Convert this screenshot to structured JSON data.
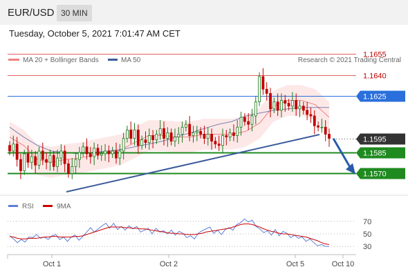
{
  "header": {
    "pair": "EUR/USD",
    "timeframe": "30 MIN"
  },
  "timestamp": "Tuesday, October 5, 2021 7:01:47 AM CET",
  "legend": {
    "ma20_bb": "MA 20 + Bollinger Bands",
    "ma50": "MA 50",
    "copyright": "Research © 2021 Trading Central",
    "ma20_color": "#f08080",
    "ma50_color": "#3d5a99"
  },
  "rsi_legend": {
    "rsi": "RSI",
    "ma9": "9MA",
    "rsi_color": "#5b7fd6",
    "ma9_color": "#cc0000"
  },
  "colors": {
    "up": "#1a7a1a",
    "down": "#c00000",
    "resistance": "#e06060",
    "pivot": "#2a6fdb",
    "support": "#1f8a1f",
    "trend": "#3a5a9a",
    "band_fill": "#fbd9d9"
  },
  "chart_data": {
    "type": "candlestick",
    "x_ticks": [
      "Oct 1",
      "Oct 2",
      "Oct 5",
      "Oct 10"
    ],
    "y_range": [
      1.1556,
      1.1666
    ],
    "levels": [
      {
        "price": 1.1655,
        "label": "1.1655",
        "kind": "resistance"
      },
      {
        "price": 1.164,
        "label": "1.1640",
        "kind": "resistance"
      },
      {
        "price": 1.1625,
        "label": "1.1625",
        "kind": "pivot"
      },
      {
        "price": 1.1595,
        "label": "1.1595",
        "kind": "last"
      },
      {
        "price": 1.1585,
        "label": "1.1585",
        "kind": "support"
      },
      {
        "price": 1.157,
        "label": "1.1570",
        "kind": "support"
      }
    ],
    "closes": [
      1.1586,
      1.1591,
      1.158,
      1.1572,
      1.1584,
      1.1578,
      1.1582,
      1.1576,
      1.1586,
      1.158,
      1.1578,
      1.1583,
      1.1575,
      1.1581,
      1.1586,
      1.1577,
      1.157,
      1.1575,
      1.158,
      1.1585,
      1.1589,
      1.1584,
      1.1582,
      1.1588,
      1.1583,
      1.1584,
      1.1586,
      1.1584,
      1.1586,
      1.1581,
      1.1586,
      1.1595,
      1.1601,
      1.1595,
      1.1601,
      1.159,
      1.1594,
      1.1592,
      1.1597,
      1.1594,
      1.1598,
      1.1602,
      1.1595,
      1.1599,
      1.1593,
      1.1596,
      1.1598,
      1.1603,
      1.1605,
      1.1597,
      1.1599,
      1.16,
      1.1598,
      1.1595,
      1.1598,
      1.1593,
      1.1591,
      1.159,
      1.1597,
      1.1596,
      1.1599,
      1.1597,
      1.1603,
      1.161,
      1.1607,
      1.1605,
      1.1611,
      1.1621,
      1.1639,
      1.163,
      1.1627,
      1.1616,
      1.1621,
      1.1615,
      1.1622,
      1.162,
      1.1618,
      1.1622,
      1.1616,
      1.1618,
      1.1615,
      1.1612,
      1.1611,
      1.1604,
      1.1603,
      1.1603,
      1.1598,
      1.1595
    ],
    "ma50": [
      1.1603,
      1.1596,
      1.159,
      1.1586,
      1.1585,
      1.1584,
      1.1585,
      1.1586,
      1.1587,
      1.1589,
      1.1591,
      1.1593,
      1.1596,
      1.1599,
      1.1602,
      1.1605,
      1.1607,
      1.1611,
      1.1613,
      1.1615,
      1.1616,
      1.1617,
      1.1617,
      1.1617
    ],
    "ma20": [
      1.1596,
      1.159,
      1.158,
      1.1578,
      1.158,
      1.1581,
      1.1583,
      1.1585,
      1.1587,
      1.1592,
      1.1597,
      1.1597,
      1.1596,
      1.1596,
      1.1598,
      1.1598,
      1.1598,
      1.16,
      1.1606,
      1.1618,
      1.1622,
      1.1622,
      1.1619,
      1.161
    ],
    "projection": {
      "from": 1.1595,
      "to": 1.157
    },
    "rsi": {
      "ticks": [
        70,
        50,
        30
      ],
      "range": [
        18,
        82
      ],
      "values": [
        47,
        42,
        36,
        41,
        37,
        45,
        44,
        49,
        43,
        45,
        41,
        47,
        49,
        41,
        45,
        38,
        45,
        48,
        40,
        46,
        53,
        60,
        53,
        58,
        63,
        67,
        59,
        67,
        57,
        62,
        56,
        63,
        58,
        62,
        53,
        56,
        59,
        50,
        59,
        53,
        55,
        50,
        56,
        48,
        54,
        51,
        44,
        47,
        42,
        51,
        55,
        58,
        61,
        51,
        56,
        49,
        57,
        60,
        56,
        65,
        68,
        74,
        69,
        72,
        62,
        58,
        52,
        55,
        48,
        57,
        47,
        54,
        51,
        44,
        48,
        43,
        45,
        38,
        42,
        36,
        31,
        33,
        30,
        30
      ],
      "ma9": [
        46,
        45,
        43,
        42,
        42,
        43,
        43,
        43,
        44,
        45,
        45,
        46,
        46,
        45,
        45,
        45,
        45,
        46,
        46,
        47,
        49,
        51,
        53,
        55,
        57,
        59,
        61,
        61,
        61,
        61,
        60,
        60,
        59,
        59,
        58,
        58,
        57,
        56,
        55,
        54,
        53,
        52,
        51,
        51,
        50,
        50,
        49,
        49,
        49,
        50,
        51,
        53,
        54,
        55,
        56,
        57,
        58,
        59,
        61,
        63,
        65,
        66,
        66,
        65,
        63,
        61,
        58,
        56,
        54,
        53,
        51,
        50,
        50,
        49,
        48,
        47,
        46,
        45,
        43,
        41,
        39,
        36,
        34,
        33
      ]
    }
  }
}
